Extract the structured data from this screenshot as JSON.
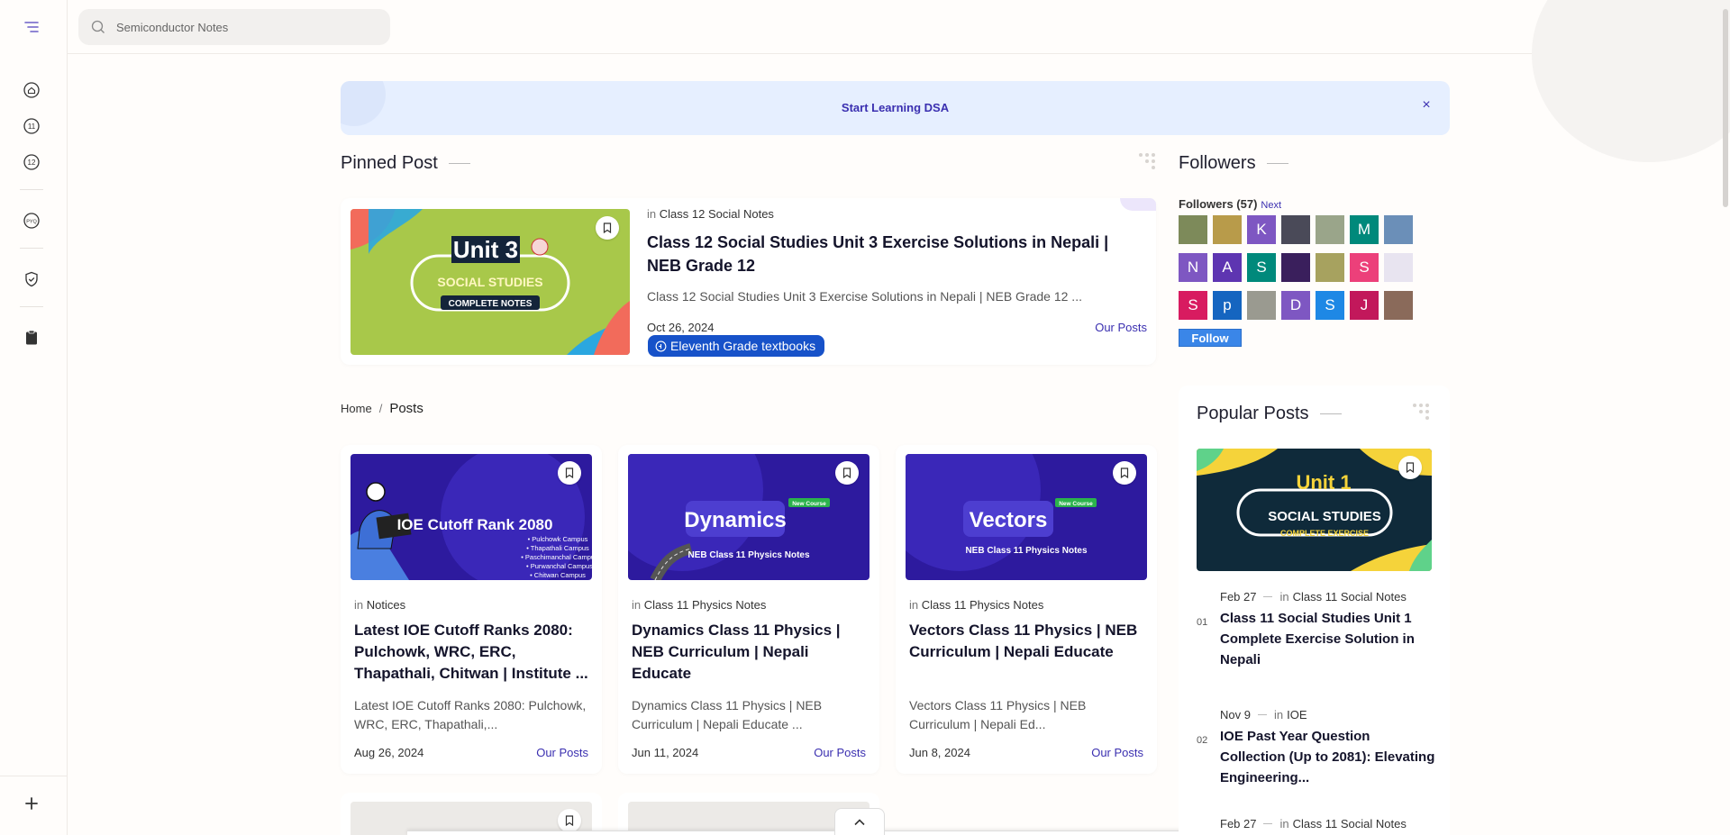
{
  "search": {
    "placeholder": "Semiconductor Notes"
  },
  "sidebar": {
    "items": [
      {
        "name": "home",
        "label": ""
      },
      {
        "name": "class-11",
        "label": "11"
      },
      {
        "name": "class-12",
        "label": "12"
      },
      {
        "name": "pyq",
        "label": "PYQ"
      },
      {
        "name": "shield",
        "label": ""
      },
      {
        "name": "clipboard",
        "label": ""
      }
    ]
  },
  "banner": {
    "text": "Start Learning DSA",
    "close": "×"
  },
  "pinned_section": {
    "title": "Pinned Post"
  },
  "pinned": {
    "in": "in",
    "category": "Class 12 Social Notes",
    "title": "Class 12 Social Studies Unit 3 Exercise Solutions in Nepali | NEB Grade 12",
    "description": "Class 12 Social Studies Unit 3 Exercise Solutions in Nepali | NEB Grade 12 ...",
    "date": "Oct 26, 2024",
    "badge": "Eleventh Grade textbooks",
    "link": "Our Posts",
    "thumb": {
      "big": "Unit 3",
      "sub": "SOCIAL STUDIES",
      "tag": "COMPLETE NOTES"
    }
  },
  "breadcrumb": {
    "home": "Home",
    "sep": "/",
    "current": "Posts"
  },
  "posts": [
    {
      "in": "in",
      "category": "Notices",
      "title": "Latest IOE Cutoff Ranks 2080: Pulchowk, WRC, ERC, Thapathali, Chitwan | Institute ...",
      "description": "Latest IOE Cutoff Ranks 2080: Pulchowk, WRC, ERC, Thapathali,...",
      "date": "Aug 26, 2024",
      "link": "Our Posts",
      "thumb": {
        "big": "IOE Cutoff Rank 2080",
        "lines": [
          "• Pulchowk Campus",
          "• Thapathali Campus",
          "• Paschimanchal Campus",
          "• Purwanchal Campus",
          "• Chitwan Campus"
        ]
      }
    },
    {
      "in": "in",
      "category": "Class 11 Physics Notes",
      "title": "Dynamics Class 11 Physics | NEB Curriculum | Nepali Educate",
      "description": "Dynamics Class 11 Physics | NEB Curriculum | Nepali Educate ...",
      "date": "Jun 11, 2024",
      "link": "Our Posts",
      "thumb": {
        "big": "Dynamics",
        "tag": "New Course",
        "sub": "NEB Class 11 Physics Notes"
      }
    },
    {
      "in": "in",
      "category": "Class 11 Physics Notes",
      "title": "Vectors Class 11 Physics | NEB Curriculum | Nepali Educate",
      "description": "Vectors Class 11 Physics | NEB Curriculum | Nepali Ed...",
      "date": "Jun 8, 2024",
      "link": "Our Posts",
      "thumb": {
        "big": "Vectors",
        "tag": "New Course",
        "sub": "NEB Class 11 Physics Notes"
      }
    }
  ],
  "followers_section": {
    "title": "Followers"
  },
  "followers": {
    "label": "Followers (57)",
    "next": "Next",
    "follow": "Follow",
    "avatars": [
      {
        "letter": "",
        "color": "#7d8a5a"
      },
      {
        "letter": "",
        "color": "#b89b4a"
      },
      {
        "letter": "K",
        "color": "#7e57c2"
      },
      {
        "letter": "",
        "color": "#4a4a58"
      },
      {
        "letter": "",
        "color": "#9aa58a"
      },
      {
        "letter": "M",
        "color": "#00897b"
      },
      {
        "letter": "",
        "color": "#6b8fb8"
      },
      {
        "letter": "N",
        "color": "#7e57c2"
      },
      {
        "letter": "A",
        "color": "#5e35b1"
      },
      {
        "letter": "S",
        "color": "#00897b"
      },
      {
        "letter": "",
        "color": "#3a1f5c"
      },
      {
        "letter": "",
        "color": "#a7a25f"
      },
      {
        "letter": "S",
        "color": "#ec407a"
      },
      {
        "letter": "",
        "color": "#e8e4f0"
      },
      {
        "letter": "S",
        "color": "#d81b60"
      },
      {
        "letter": "p",
        "color": "#1565c0"
      },
      {
        "letter": "",
        "color": "#9a9a90"
      },
      {
        "letter": "D",
        "color": "#7e57c2"
      },
      {
        "letter": "S",
        "color": "#1e88e5"
      },
      {
        "letter": "J",
        "color": "#c2185b"
      },
      {
        "letter": "",
        "color": "#8a6a5a"
      }
    ]
  },
  "popular_section": {
    "title": "Popular Posts"
  },
  "popular": {
    "thumb": {
      "big": "Unit 1",
      "sub": "SOCIAL STUDIES",
      "tag": "COMPLETE EXERCISE"
    },
    "items": [
      {
        "num": "01",
        "date": "Feb 27",
        "in": "in",
        "category": "Class 11 Social Notes",
        "title": "Class 11 Social Studies Unit 1 Complete Exercise Solution in Nepali"
      },
      {
        "num": "02",
        "date": "Nov 9",
        "in": "in",
        "category": "IOE",
        "title": "IOE Past Year Question Collection (Up to 2081): Elevating Engineering..."
      },
      {
        "num": "03",
        "date": "Feb 27",
        "in": "in",
        "category": "Class 11 Social Notes",
        "title": ""
      }
    ]
  },
  "colors": {
    "accent": "#3a2fb0",
    "badge": "#1752c9",
    "banner_bg": "#e6efff",
    "follow": "#3a86e8"
  }
}
